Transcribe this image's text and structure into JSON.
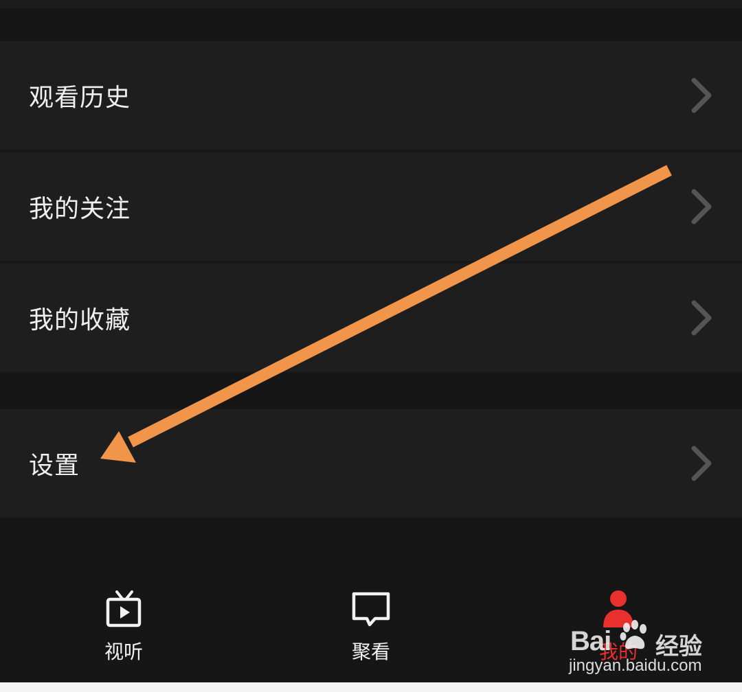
{
  "menu": {
    "items": [
      {
        "label": "观看历史",
        "icon": "chevron-right-icon"
      },
      {
        "label": "我的关注",
        "icon": "chevron-right-icon"
      },
      {
        "label": "我的收藏",
        "icon": "chevron-right-icon"
      },
      {
        "label": "设置",
        "icon": "chevron-right-icon"
      }
    ]
  },
  "tabs": [
    {
      "label": "视听",
      "icon": "tv-play-icon",
      "active": false
    },
    {
      "label": "聚看",
      "icon": "chat-bubble-icon",
      "active": false
    },
    {
      "label": "我的",
      "icon": "user-icon",
      "active": true
    }
  ],
  "annotation": {
    "color": "#f0954a",
    "icon": "arrow-annotation-icon"
  },
  "watermark": {
    "brand": "Bai",
    "brand_cn": "经验",
    "url": "jingyan.baidu.com"
  },
  "colors": {
    "background": "#161616",
    "row": "#1e1e1e",
    "active_tab": "#e8302e",
    "chevron": "#555555"
  }
}
